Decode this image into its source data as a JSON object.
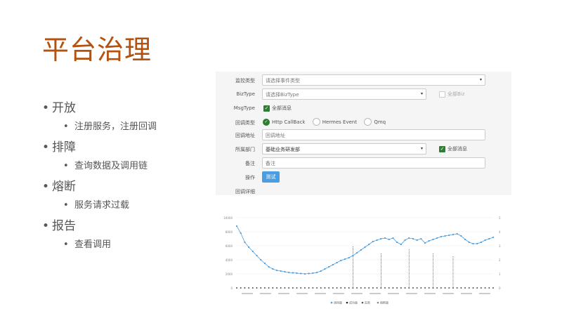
{
  "title": "平台治理",
  "bullets": [
    {
      "text": "开放",
      "sub": "注册服务，注册回调"
    },
    {
      "text": "排障",
      "sub": "查询数据及调用链"
    },
    {
      "text": "熔断",
      "sub": "服务请求过载"
    },
    {
      "text": "报告",
      "sub": "查看调用"
    }
  ],
  "form": {
    "rows": [
      {
        "label": "监控类型",
        "value": "请选择事件类型"
      },
      {
        "label": "BizType",
        "value": "请选择BizType",
        "check": "全部Biz"
      },
      {
        "label": "MsgType",
        "check": "全部消息"
      },
      {
        "label": "回调类型",
        "radios": [
          "Http CallBack",
          "Hermes Event",
          "Qmq"
        ]
      },
      {
        "label": "回调地址",
        "value": "回调地址"
      },
      {
        "label": "所属部门",
        "value": "基础业务研发部",
        "check": "全部消息"
      },
      {
        "label": "备注",
        "value": "备注"
      },
      {
        "label": "操作",
        "button": "测试"
      },
      {
        "label": "回调详细"
      }
    ]
  },
  "chart": {
    "legend": [
      "调用量",
      "成功量",
      "失败",
      "熔断量"
    ],
    "line_color": "#4a9de0",
    "y_left_labels": [
      "10000",
      "8000",
      "6000",
      "4000",
      "2000",
      "0"
    ],
    "y_right_labels": [
      "5",
      "4",
      "3",
      "2",
      "1",
      "0"
    ]
  },
  "chart_data": {
    "type": "line",
    "series": [
      {
        "name": "调用量",
        "values": [
          8800,
          7800,
          6500,
          5800,
          5200,
          4600,
          4000,
          3500,
          3000,
          2700,
          2500,
          2400,
          2300,
          2200,
          2150,
          2100,
          2050,
          2000,
          2050,
          2100,
          2200,
          2400,
          2700,
          3000,
          3300,
          3600,
          3900,
          4100,
          4300,
          4600,
          5000,
          5400,
          5800,
          6200,
          6600,
          6800,
          7000,
          7100,
          6900,
          7100,
          6500,
          6200,
          6800,
          7100,
          7000,
          6800,
          7000,
          6400,
          6700,
          6900,
          7100,
          7300,
          7400,
          7500,
          7600,
          7700,
          7400,
          6900,
          6500,
          6300,
          6300,
          6500,
          6800,
          7000,
          7200
        ]
      },
      {
        "name": "失败",
        "values": [
          0,
          0,
          0,
          0,
          0,
          0,
          0,
          0,
          0,
          0,
          0,
          0,
          0,
          0,
          0,
          0,
          0,
          0,
          0,
          0,
          0,
          0,
          0,
          0,
          0,
          0,
          0,
          0,
          0,
          3,
          0,
          0,
          0,
          0,
          0,
          0,
          2.5,
          0,
          0,
          0,
          0,
          0,
          0,
          2.8,
          0,
          0,
          0,
          0,
          0,
          2.5,
          0,
          0,
          0,
          0,
          2.3,
          0,
          0,
          0,
          0,
          0,
          0,
          0,
          0,
          0,
          0
        ]
      }
    ],
    "ylim": [
      0,
      10000
    ]
  }
}
